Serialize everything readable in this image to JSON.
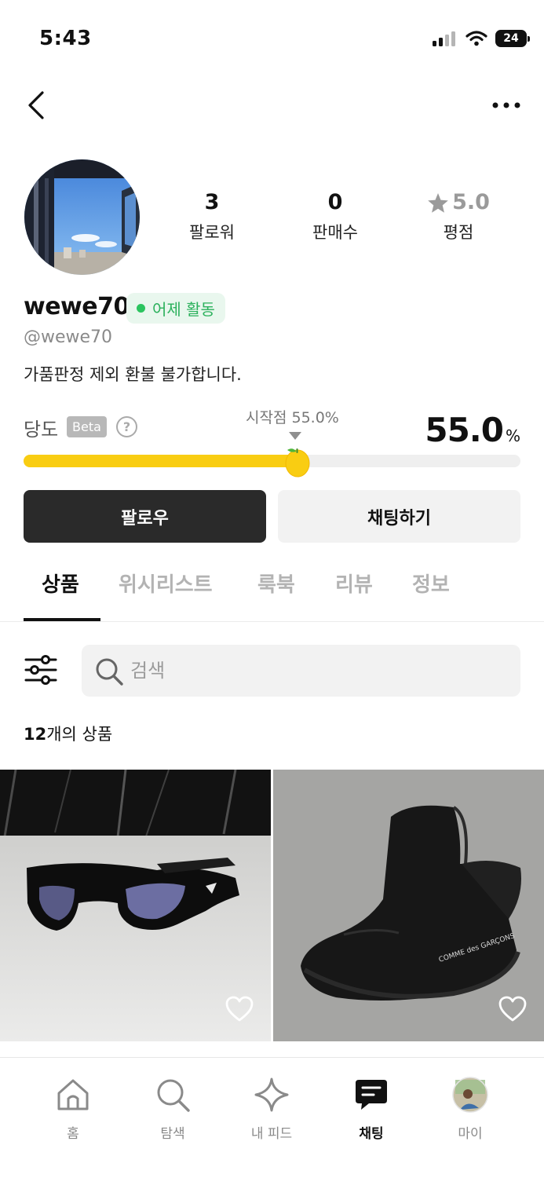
{
  "status_bar": {
    "time": "5:43",
    "battery": "24"
  },
  "profile": {
    "username": "wewe70",
    "activity": "어제 활동",
    "handle": "@wewe70",
    "bio": "가품판정 제외 환불 불가합니다.",
    "stats": [
      {
        "value": "3",
        "label": "팔로워"
      },
      {
        "value": "0",
        "label": "판매수"
      },
      {
        "value": "5.0",
        "label": "평점"
      }
    ]
  },
  "sweetness": {
    "label": "당도",
    "beta": "Beta",
    "help": "?",
    "start_label": "시작점 55.0%",
    "value": "55.0",
    "unit": "%",
    "level_percent": 55.0
  },
  "actions": {
    "follow": "팔로우",
    "chat": "채팅하기"
  },
  "tabs": [
    "상품",
    "위시리스트",
    "룩북",
    "리뷰",
    "정보"
  ],
  "search": {
    "placeholder": "검색"
  },
  "product_count": {
    "number": "12",
    "suffix": "개의 상품"
  },
  "bottom_nav": [
    {
      "label": "홈",
      "icon": "home-icon"
    },
    {
      "label": "탐색",
      "icon": "search-icon"
    },
    {
      "label": "내 피드",
      "icon": "sparkle-icon"
    },
    {
      "label": "채팅",
      "icon": "chat-icon"
    },
    {
      "label": "마이",
      "icon": "profile-avatar-icon"
    }
  ],
  "colors": {
    "accent_yellow": "#f9cd12",
    "active_green": "#2bb15c",
    "dark_button": "#2a2a2a"
  }
}
